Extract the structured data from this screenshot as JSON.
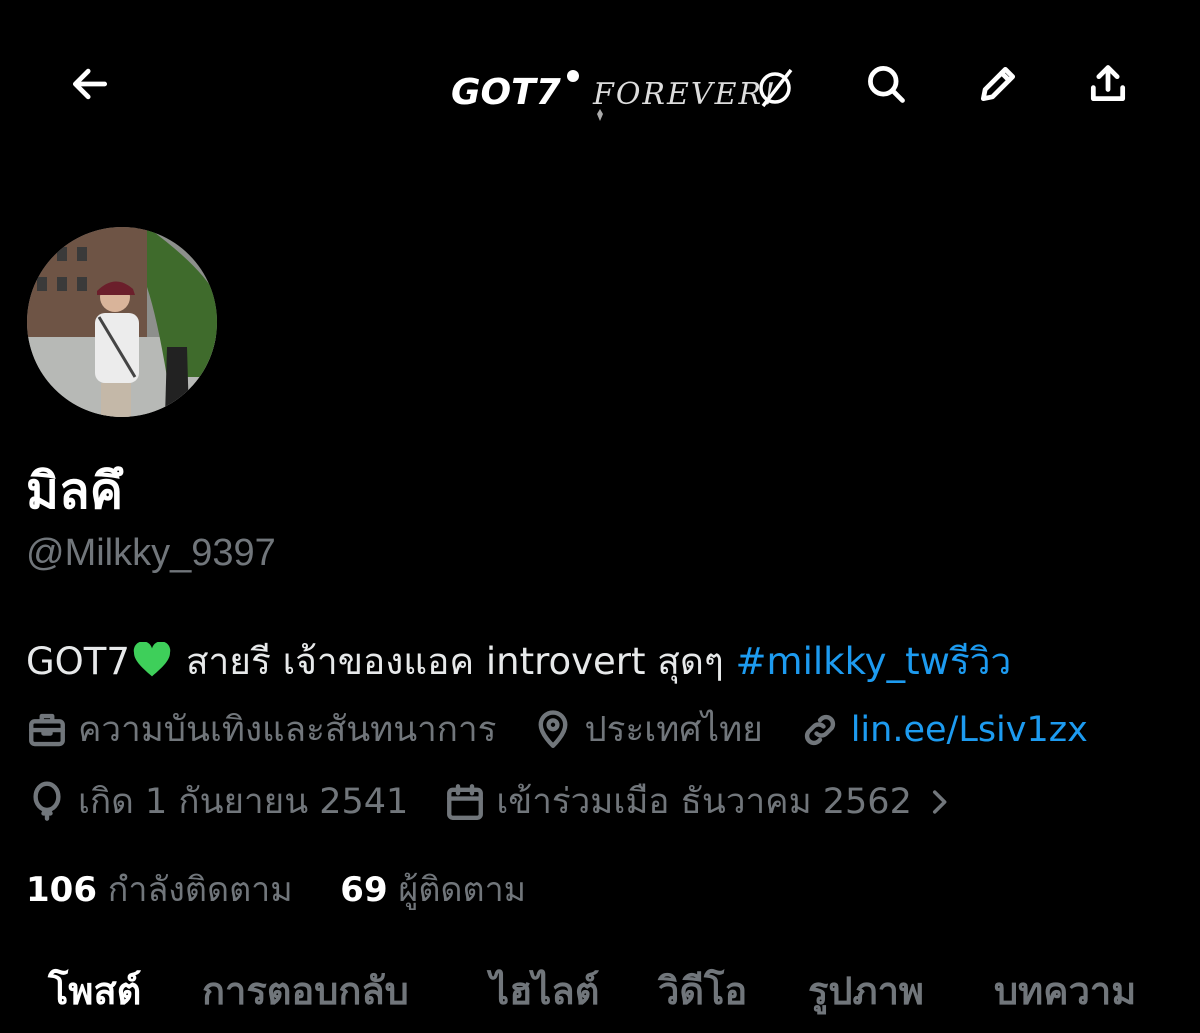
{
  "header": {
    "back_icon": "arrow-left-icon",
    "banner_text_main": "GOT7",
    "banner_text_sub": "FOREVER!",
    "actions": [
      "search-icon",
      "pencil-icon",
      "share-icon"
    ]
  },
  "profile": {
    "display_name": "มิลคึ",
    "handle": "@Milkky_9397",
    "bio_text": "GOT7",
    "bio_rest": "สายรี เจ้าของแอค introvert สุดๆ",
    "bio_hashtag": "#milkky_twรีวิว",
    "category": "ความบันเทิงและสันทนาการ",
    "location": "ประเทศไทย",
    "website": "lin.ee/Lsiv1zx",
    "birthday": "เกิด 1 กันยายน 2541",
    "joined": "เข้าร่วมเมือ ธันวาคม 2562"
  },
  "stats": {
    "following_count": "106",
    "following_label": "กำลังติดตาม",
    "followers_count": "69",
    "followers_label": "ผู้ติดตาม"
  },
  "tabs": [
    "โพสต์",
    "การตอบกลับ",
    "ไฮไลต์",
    "วิดีโอ",
    "รูปภาพ",
    "บทความ"
  ],
  "colors": {
    "background": "#000000",
    "link": "#1d9bf0",
    "muted": "#71767b",
    "heart": "#3ecf5a"
  }
}
